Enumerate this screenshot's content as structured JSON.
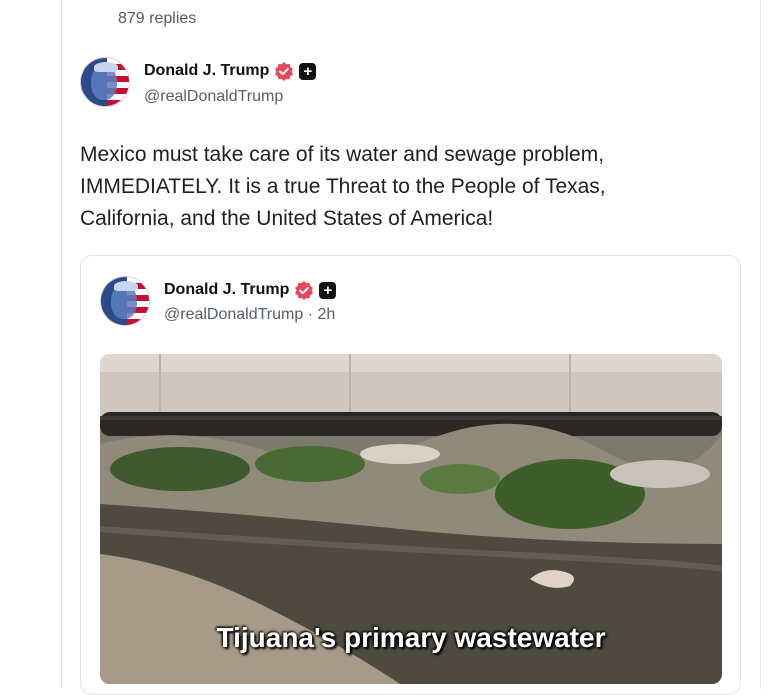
{
  "thread": {
    "replies_label": "879 replies"
  },
  "post": {
    "author": {
      "name": "Donald J. Trump",
      "handle": "@realDonaldTrump",
      "verified": true,
      "badge_icon": "plus-badge-icon"
    },
    "text_lines": [
      "Mexico must take care of its water and sewage problem,",
      "IMMEDIATELY. It is a true Threat to the People of Texas,",
      "California, and the United States of America!"
    ]
  },
  "quoted_post": {
    "author": {
      "name": "Donald J. Trump",
      "handle_time": "@realDonaldTrump · 2h",
      "verified": true
    },
    "video": {
      "caption": "Tijuana's primary wastewater"
    }
  },
  "colors": {
    "verified_badge": "#e8465c",
    "text_secondary": "#55606a",
    "card_border": "#e3e3e3"
  }
}
